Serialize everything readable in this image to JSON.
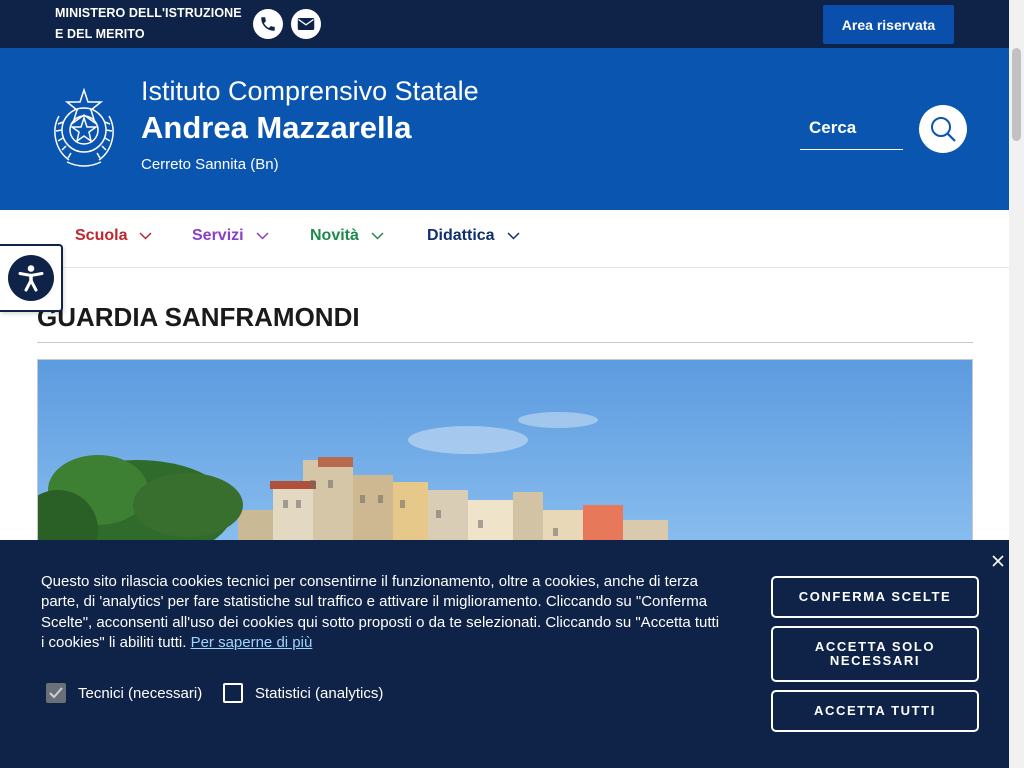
{
  "topbar": {
    "ministry_line1": "MINISTERO DELL'ISTRUZIONE",
    "ministry_line2": "E DEL MERITO",
    "phone_icon": "phone-icon",
    "mail_icon": "mail-icon",
    "reserved_area": "Area riservata",
    "bg_color": "#0e2347"
  },
  "header": {
    "line1": "Istituto Comprensivo Statale",
    "line2": "Andrea Mazzarella",
    "city": "Cerreto Sannita (Bn)",
    "search_label": "Cerca",
    "emblem_icon": "italian-republic-emblem-icon",
    "bg_color": "#0a55b0"
  },
  "nav": {
    "items": [
      {
        "label": "Scuola",
        "color": "#c0262d"
      },
      {
        "label": "Servizi",
        "color": "#8a3fc6"
      },
      {
        "label": "Novità",
        "color": "#1e8a4e"
      },
      {
        "label": "Didattica",
        "color": "#0e2f6e"
      }
    ]
  },
  "accessibility": {
    "icon": "accessibility-icon"
  },
  "page": {
    "title": "GUARDIA SANFRAMONDI"
  },
  "cookie": {
    "text": "Questo sito rilascia cookies tecnici per consentirne il funzionamento, oltre a cookies, anche di terza parte, di 'analytics' per fare statistiche sul traffico e attivare il miglioramento. Cliccando su \"Conferma Scelte\", acconsenti all'uso dei cookies qui sotto proposti o da te selezionati. Cliccando su \"Accetta tutti i cookies\" li abiliti tutti.",
    "link": "Per saperne di più",
    "checks": [
      {
        "label": "Tecnici (necessari)",
        "checked": true
      },
      {
        "label": "Statistici (analytics)",
        "checked": false
      }
    ],
    "buttons": {
      "confirm": "CONFERMA SCELTE",
      "necessary": "ACCETTA SOLO NECESSARI",
      "all": "ACCETTA TUTTI"
    }
  }
}
